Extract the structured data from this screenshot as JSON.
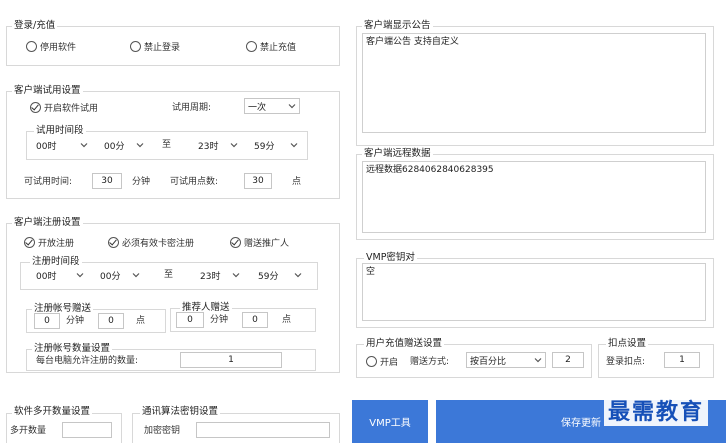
{
  "login_recharge": {
    "title": "登录/充值",
    "options": [
      "停用软件",
      "禁止登录",
      "禁止充值"
    ]
  },
  "trial": {
    "title": "客户端试用设置",
    "enable_label": "开启软件试用",
    "cycle_label": "试用周期:",
    "cycle_value": "一次",
    "period_title": "试用时间段",
    "start_hour": "00时",
    "start_min": "00分",
    "to": "至",
    "end_hour": "23时",
    "end_min": "59分",
    "time_label": "可试用时间:",
    "time_value": "30",
    "time_unit": "分钟",
    "points_label": "可试用点数:",
    "points_value": "30",
    "points_unit": "点"
  },
  "register": {
    "title": "客户端注册设置",
    "opt_open": "开放注册",
    "opt_require_card": "必须有效卡密注册",
    "opt_gift_promoter": "赠送推广人",
    "period_title": "注册时间段",
    "start_hour": "00时",
    "start_min": "00分",
    "to": "至",
    "end_hour": "23时",
    "end_min": "59分",
    "gift_title": "注册帐号赠送",
    "gift_min": "0",
    "gift_min_unit": "分钟",
    "gift_pts": "0",
    "gift_pts_unit": "点",
    "ref_title": "推荐人赠送",
    "ref_min": "0",
    "ref_min_unit": "分钟",
    "ref_pts": "0",
    "ref_pts_unit": "点",
    "count_title": "注册帐号数量设置",
    "count_label": "每台电脑允许注册的数量:",
    "count_value": "1"
  },
  "multi_open": {
    "title": "软件多开数量设置",
    "label": "多开数量"
  },
  "comm_key": {
    "title": "通讯算法密钥设置",
    "label": "加密密钥"
  },
  "announcement": {
    "title": "客户端显示公告",
    "content": "客户端公告 支持自定义"
  },
  "remote_data": {
    "title": "客户端远程数据",
    "content": "远程数据6284062840628395"
  },
  "vmp_key": {
    "title": "VMP密钥对",
    "content": "空"
  },
  "recharge_gift": {
    "title": "用户充值赠送设置",
    "enable_label": "开启",
    "mode_label": "赠送方式:",
    "mode_value": "按百分比",
    "value": "2"
  },
  "deduct": {
    "title": "扣点设置",
    "label": "登录扣点:",
    "value": "1"
  },
  "buttons": {
    "vmp_tool": "VMP工具",
    "save": "保存更新"
  },
  "watermark": "最需教育",
  "colors": {
    "accent": "#3c78d8",
    "border": "#d8d8d8"
  }
}
